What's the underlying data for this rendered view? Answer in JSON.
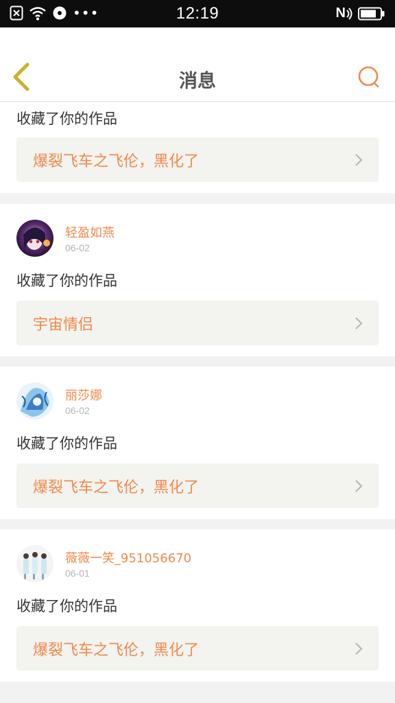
{
  "status_bar": {
    "time": "12:19",
    "nfc": "N",
    "dots": "•••",
    "icons": [
      "close-box-icon",
      "wifi-icon",
      "disc-icon",
      "nfc-icon",
      "battery-icon"
    ]
  },
  "header": {
    "title": "消息",
    "back_icon": "chevron-left-icon",
    "search_icon": "search-icon",
    "accent_color": "#f08a4b",
    "back_color": "#c9b227"
  },
  "messages": [
    {
      "action": "收藏了你的作品",
      "work_title": "爆裂飞车之飞伦，黑化了"
    },
    {
      "username": "轻盈如燕",
      "date": "06-02",
      "action": "收藏了你的作品",
      "work_title": "宇宙情侣"
    },
    {
      "username": "丽莎娜",
      "date": "06-02",
      "action": "收藏了你的作品",
      "work_title": "爆裂飞车之飞伦，黑化了"
    },
    {
      "username": "薇薇一笑_951056670",
      "date": "06-01",
      "action": "收藏了你的作品",
      "work_title": "爆裂飞车之飞伦，黑化了"
    }
  ]
}
